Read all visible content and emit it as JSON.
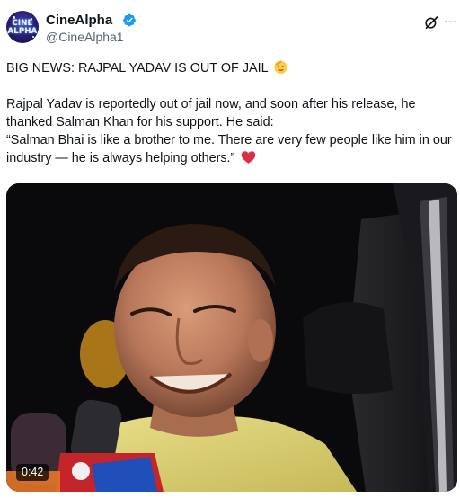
{
  "author": {
    "name": "CineAlpha",
    "handle": "@CineAlpha1",
    "avatar_text": [
      "CINE",
      "ALPHA"
    ],
    "verified": true,
    "verified_color": "#1d9bf0"
  },
  "header_actions": {
    "grok_icon": "grok-icon",
    "more_icon": "more-icon",
    "more_label": "···"
  },
  "tweet": {
    "headline": "BIG NEWS: RAJPAL YADAV IS OUT OF JAIL",
    "headline_emoji": "saluting-face",
    "body_line1": "Rajpal Yadav is reportedly out of jail now, and soon after his release, he thanked Salman Khan for his support. He said:",
    "quote": "“Salman Bhai is like a brother to me. There are very few people like him in our industry — he is always helping others.”",
    "quote_emoji": "red-heart"
  },
  "media": {
    "type": "video",
    "duration": "0:42"
  },
  "colors": {
    "text": "#0f1419",
    "secondary": "#536471",
    "accent": "#1d9bf0",
    "heart": "#f91880"
  }
}
